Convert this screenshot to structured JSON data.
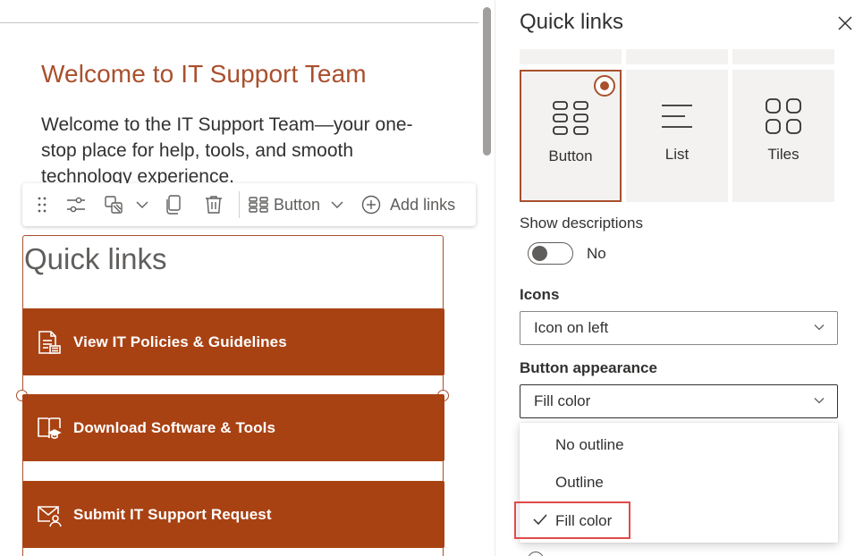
{
  "canvas": {
    "welcome_title": "Welcome to IT Support Team",
    "welcome_body": "Welcome to the IT Support Team—your one-stop place for help, tools, and smooth technology experience."
  },
  "toolbar": {
    "layout_label": "Button",
    "add_links_label": "Add links",
    "icons": [
      "drag-handle-icon",
      "settings-sliders-icon",
      "styles-icon",
      "chevron-down-icon",
      "duplicate-icon",
      "trash-icon",
      "button-layout-icon",
      "chevron-down-icon",
      "add-circle-icon"
    ]
  },
  "webpart": {
    "heading": "Quick links",
    "buttons": [
      {
        "label": "View IT Policies & Guidelines",
        "icon": "document-lines-icon"
      },
      {
        "label": "Download Software & Tools",
        "icon": "book-graduation-icon"
      },
      {
        "label": "Submit IT Support Request",
        "icon": "mail-person-icon"
      }
    ],
    "button_color": "#a94213",
    "accent_color": "#a9502d"
  },
  "panel": {
    "title": "Quick links",
    "layouts": [
      {
        "label": "Button",
        "selected": true,
        "icon": "button-grid-icon"
      },
      {
        "label": "List",
        "selected": false,
        "icon": "list-lines-icon"
      },
      {
        "label": "Tiles",
        "selected": false,
        "icon": "tiles-icon"
      }
    ],
    "show_descriptions_label": "Show descriptions",
    "show_descriptions_state": "No",
    "icons_label": "Icons",
    "icons_value": "Icon on left",
    "button_appearance_label": "Button appearance",
    "button_appearance_value": "Fill color",
    "appearance_options": [
      {
        "label": "No outline",
        "checked": false
      },
      {
        "label": "Outline",
        "checked": false
      },
      {
        "label": "Fill color",
        "checked": true
      }
    ]
  }
}
